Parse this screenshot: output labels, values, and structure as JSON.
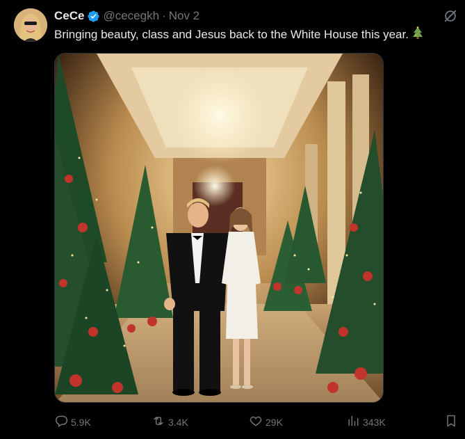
{
  "author": {
    "display_name": "CeCe",
    "handle": "@cecegkh",
    "separator": "·",
    "date": "Nov 2",
    "verified": true
  },
  "tweet": {
    "text": "Bringing beauty, class and Jesus back to the White House this year.",
    "emoji": "christmas-tree"
  },
  "stats": {
    "replies": "5.9K",
    "reposts": "3.4K",
    "likes": "29K",
    "views": "343K"
  },
  "icons": {
    "reply": "reply-icon",
    "repost": "repost-icon",
    "like": "heart-icon",
    "views": "views-icon",
    "bookmark": "bookmark-icon",
    "grok": "grok-icon",
    "verified": "verified-badge-icon"
  },
  "colors": {
    "background": "#000000",
    "text": "#e7e9ea",
    "muted": "#71767b",
    "verified": "#1d9bf0"
  }
}
